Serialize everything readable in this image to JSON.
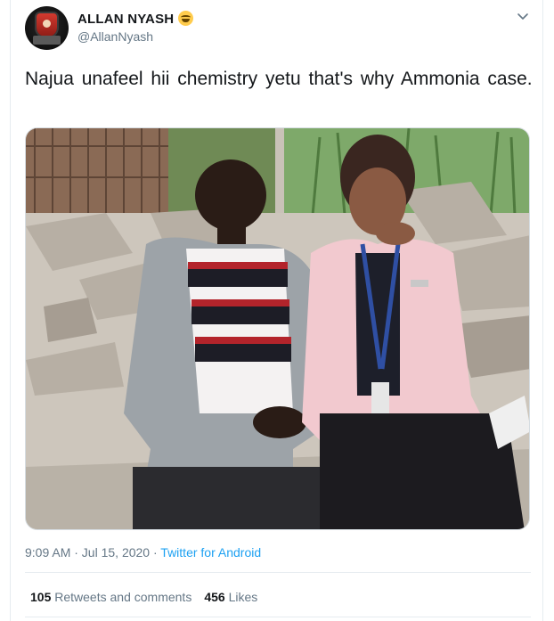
{
  "author": {
    "display_name": "ALLAN NYASH",
    "handle": "@AllanNyash",
    "name_emoji": "face-with-tears-of-joy-icon"
  },
  "tweet": {
    "text": "Najua  unafeel hii chemistry yetu that's  why  Ammonia case.",
    "timestamp": "9:09 AM · Jul 15, 2020",
    "separator": " · ",
    "source": "Twitter for Android"
  },
  "stats": {
    "retweets_count": "105",
    "retweets_label": "Retweets and comments",
    "likes_count": "456",
    "likes_label": "Likes"
  },
  "colors": {
    "link": "#1da1f2",
    "secondary_text": "#657786",
    "primary_text": "#14171a"
  },
  "icons": [
    "chevron-down-icon",
    "face-with-tears-of-joy-icon"
  ]
}
